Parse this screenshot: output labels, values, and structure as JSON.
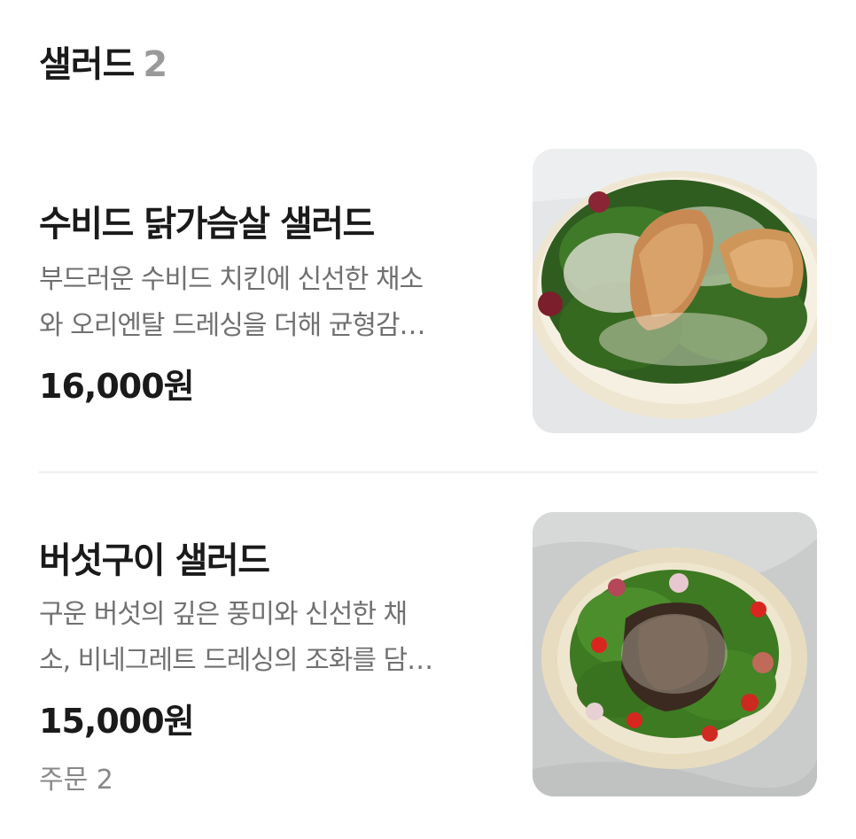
{
  "section": {
    "title": "샐러드",
    "count": "2"
  },
  "items": [
    {
      "name": "수비드 닭가슴살 샐러드",
      "desc_line1": "부드러운 수비드 치킨에 신선한 채소",
      "desc_line2": "와 오리엔탈 드레싱을 더해 균형감…",
      "price": "16,000원",
      "image": "chicken-salad-photo"
    },
    {
      "name": "버섯구이 샐러드",
      "desc_line1": "구운 버섯의 깊은 풍미와 신선한 채",
      "desc_line2": "소, 비네그레트 드레싱의 조화를 담…",
      "price": "15,000원",
      "orders": "주문 2",
      "image": "mushroom-salad-photo"
    }
  ]
}
